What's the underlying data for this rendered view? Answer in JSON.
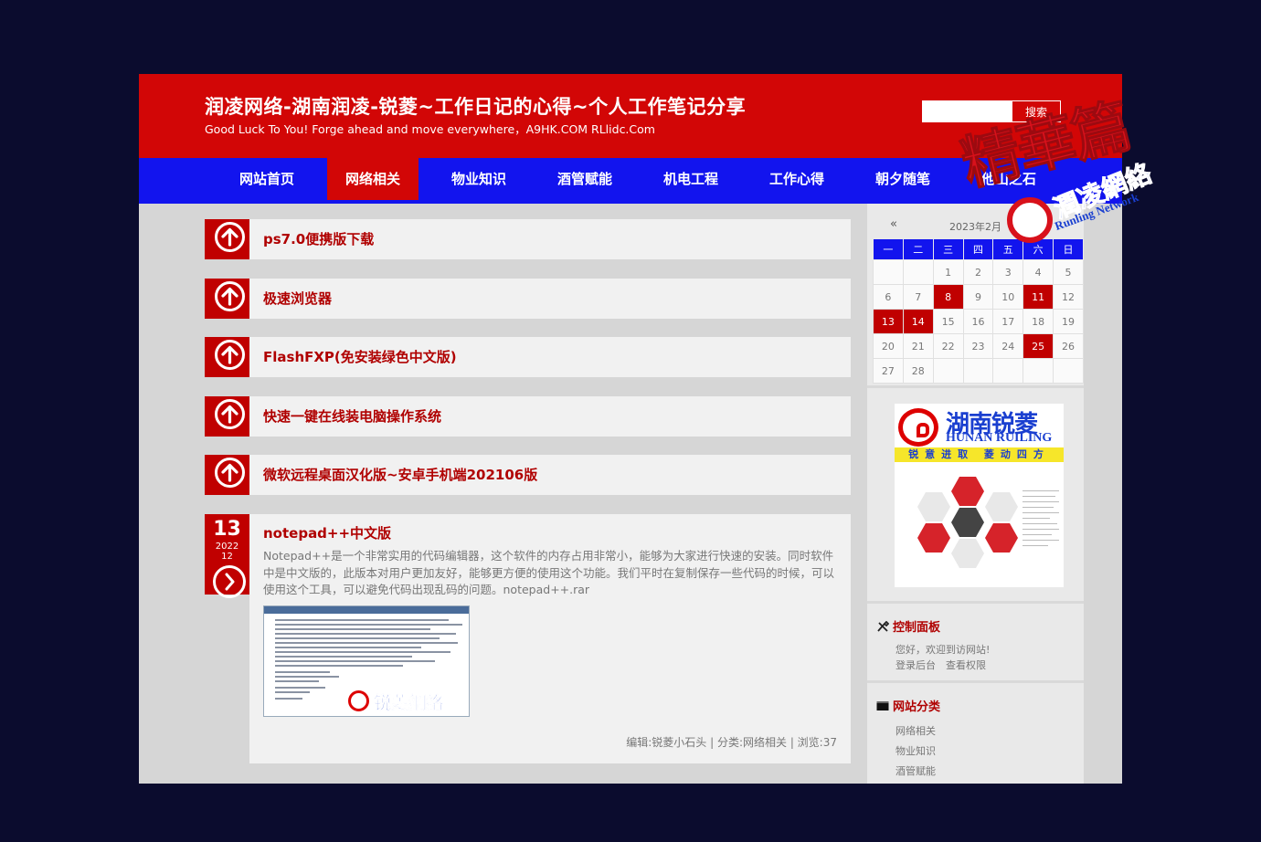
{
  "header": {
    "title": "润凌网络-湖南润凌-锐菱~工作日记的心得~个人工作笔记分享",
    "subtitle": "Good Luck To You! Forge ahead and move everywhere，A9HK.COM RLlidc.Com",
    "search_placeholder": "",
    "search_button": "搜索"
  },
  "nav": {
    "items": [
      {
        "label": "网站首页"
      },
      {
        "label": "网络相关",
        "active": true
      },
      {
        "label": "物业知识"
      },
      {
        "label": "酒管赋能"
      },
      {
        "label": "机电工程"
      },
      {
        "label": "工作心得"
      },
      {
        "label": "朝夕随笔"
      },
      {
        "label": "他山之石"
      }
    ]
  },
  "posts": [
    {
      "title": "ps7.0便携版下载"
    },
    {
      "title": "极速浏览器"
    },
    {
      "title": "FlashFXP(免安装绿色中文版)"
    },
    {
      "title": "快速一键在线装电脑操作系统"
    },
    {
      "title": "微软远程桌面汉化版~安卓手机端202106版"
    }
  ],
  "featured": {
    "day": "13",
    "year": "2022",
    "month": "12",
    "title": "notepad++中文版",
    "excerpt": "Notepad++是一个非常实用的代码编辑器，这个软件的内存占用非常小，能够为大家进行快速的安装。同时软件中是中文版的，此版本对用户更加友好，能够更方便的使用这个功能。我们平时在复制保存一些代码的时候，可以使用这个工具，可以避免代码出现乱码的问题。notepad++.rar",
    "thumb_logo_text": "锐菱網絡",
    "meta": "编辑:锐菱小石头 | 分类:网络相关 | 浏览:37"
  },
  "calendar": {
    "prev": "«",
    "title": "2023年2月",
    "weekdays": [
      "一",
      "二",
      "三",
      "四",
      "五",
      "六",
      "日"
    ],
    "weeks": [
      [
        "",
        "",
        "1",
        "2",
        "3",
        "4",
        "5"
      ],
      [
        "6",
        "7",
        "8",
        "9",
        "10",
        "11",
        "12"
      ],
      [
        "13",
        "14",
        "15",
        "16",
        "17",
        "18",
        "19"
      ],
      [
        "20",
        "21",
        "22",
        "23",
        "24",
        "25",
        "26"
      ],
      [
        "27",
        "28",
        "",
        "",
        "",
        "",
        ""
      ]
    ],
    "highlighted": [
      "8",
      "11",
      "13",
      "14",
      "25"
    ]
  },
  "banner": {
    "name_cn": "湖南锐菱",
    "name_en": "HUNAN RUILING",
    "slogan": "锐意进取 菱动四方"
  },
  "control_panel": {
    "title": "控制面板",
    "welcome": "您好，欢迎到访网站!",
    "login": "登录后台",
    "permissions": "查看权限"
  },
  "categories": {
    "title": "网站分类",
    "items": [
      "网络相关",
      "物业知识",
      "酒管赋能"
    ]
  },
  "watermark": {
    "big": "精華篇",
    "cn": "潤凌網絡",
    "en": "Runling Network"
  },
  "colors": {
    "background": "#0b0c2e",
    "brand_red": "#d20606",
    "nav_blue": "#1214ee",
    "post_title_red": "#b00000"
  }
}
